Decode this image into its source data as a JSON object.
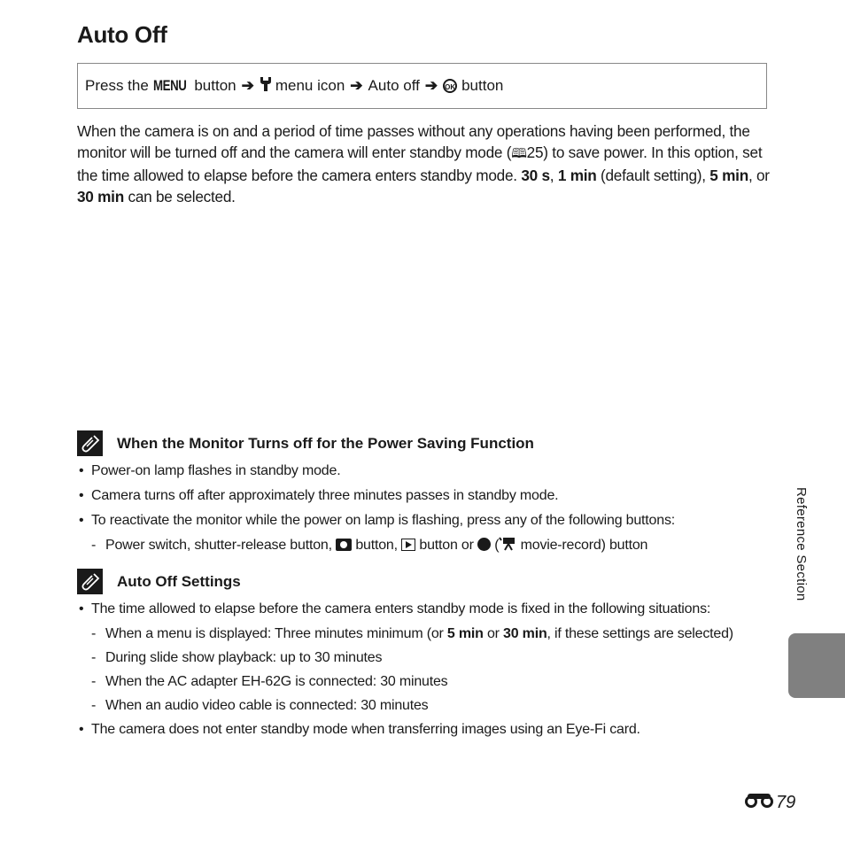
{
  "page": {
    "title": "Auto Off",
    "nav_path": {
      "prefix": "Press the",
      "menu_word": "MENU",
      "step1": "button",
      "step2": "menu icon",
      "step3": "Auto off",
      "step4": "button",
      "arrow": "➔",
      "ok_glyph": "OK",
      "wrench_glyph": "Ψ"
    },
    "intro": {
      "p1": "When the camera is on and a period of time passes without any operations having been performed, the monitor will be turned off and the camera will enter standby mode (",
      "ref_page": "25",
      "p2": ") to save power. In this option, set the time allowed to elapse before the camera enters standby mode. ",
      "opt1": "30 s",
      "sep1": ", ",
      "opt2": "1 min",
      "p3": " (default setting), ",
      "opt3": "5 min",
      "p4": ", or ",
      "opt4": "30 min",
      "p5": " can be selected."
    },
    "note1": {
      "heading": "When the Monitor Turns off for the Power Saving Function",
      "b1": "Power-on lamp flashes in standby mode.",
      "b2": "Camera turns off after approximately three minutes passes in standby mode.",
      "b3": "To reactivate the monitor while the power on lamp is flashing, press any of the following buttons:",
      "d1_a": "Power switch, shutter-release button,",
      "d1_b": "button,",
      "d1_c": "button or",
      "d1_d": "(",
      "d1_e": "movie-record) button"
    },
    "note2": {
      "heading": "Auto Off Settings",
      "b1": "The time allowed to elapse before the camera enters standby mode is fixed in the following situations:",
      "d1_a": "When a menu is displayed: Three minutes minimum (or ",
      "d1_b": "5 min",
      "d1_c": " or ",
      "d1_d": "30 min",
      "d1_e": ", if these settings are selected)",
      "d2": "During slide show playback: up to 30 minutes",
      "d3": "When the AC adapter EH-62G is connected: 30 minutes",
      "d4": "When an audio video cable is connected: 30 minutes",
      "b2": "The camera does not enter standby mode when transferring images using an Eye-Fi card."
    },
    "side_label": "Reference Section",
    "page_number": "79",
    "colors": {
      "text": "#1a1a1a",
      "tab": "#808080",
      "border": "#888888"
    }
  }
}
